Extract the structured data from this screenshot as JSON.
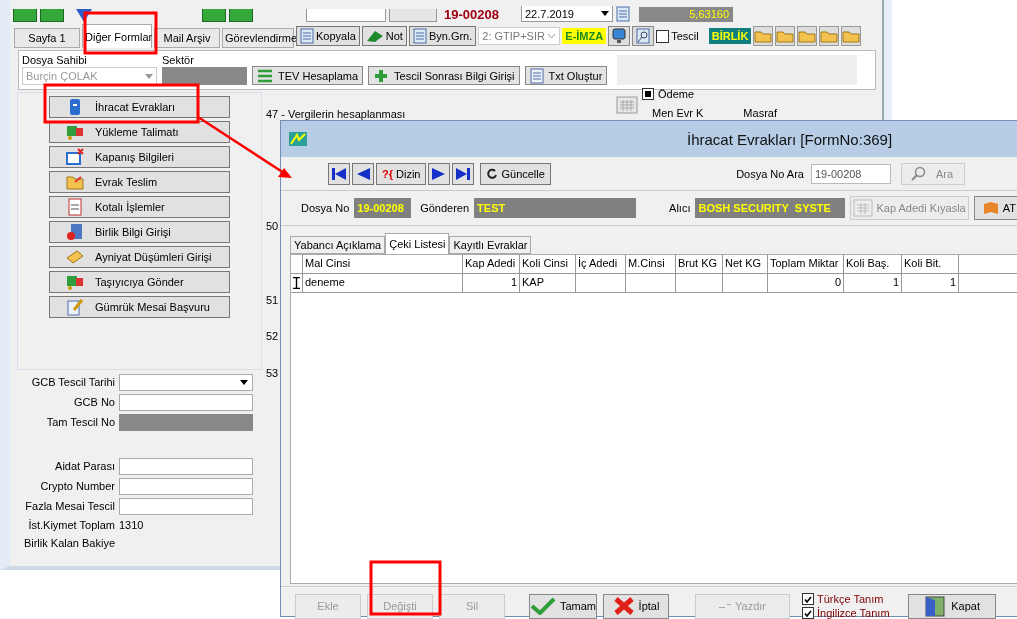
{
  "main_window": {
    "top_bar": {
      "file_no": "19-00208",
      "date": "22.7.2019",
      "rate": "5,63160"
    },
    "tabs": [
      {
        "label": "Sayfa 1",
        "selected": false
      },
      {
        "label": "Diğer Formlar",
        "selected": true
      },
      {
        "label": "Mail Arşiv",
        "selected": false
      },
      {
        "label": "Görevlendirme",
        "selected": false
      }
    ],
    "toolbar": {
      "buttons": [
        "Kopyala",
        "Not",
        "Byn.Grn."
      ],
      "mode_dropdown": "2: GTIP+SIR",
      "eimza": "E-İMZA",
      "tescil": {
        "label": "Tescil",
        "checked": false
      },
      "birlik": "BİRLİK"
    },
    "header": {
      "owner_label": "Dosya Sahibi",
      "owner_value": "Burçin ÇOLAK",
      "sector_label": "Sektör",
      "buttons": [
        "TEV Hesaplama",
        "Tescil Sonrası Bilgi Girişi",
        "Txt Oluştur"
      ]
    },
    "form_buttons": [
      "İhracat Evrakları",
      "Yükleme Talimatı",
      "Kapanış Bilgileri",
      "Evrak Teslim",
      "Kotalı İşlemler",
      "Birlik Bilgi Girişi",
      "Ayniyat Düşümleri Girişi",
      "Taşıyıcıya Gönder",
      "Gümrük Mesai Başvuru"
    ],
    "fields_top": [
      {
        "label": "GCB Tescil Tarihi",
        "kind": "dropdown"
      },
      {
        "label": "GCB No",
        "kind": "input"
      },
      {
        "label": "Tam Tescil No",
        "kind": "readonly"
      }
    ],
    "fields_bottom": [
      {
        "label": "Aidat Parası",
        "kind": "input"
      },
      {
        "label": "Crypto Number",
        "kind": "input"
      },
      {
        "label": "Fazla Mesai Tescil",
        "kind": "input"
      },
      {
        "label": "İst.Kiymet Toplam",
        "kind": "text",
        "value": "1310"
      },
      {
        "label": "Birlik Kalan Bakiye",
        "kind": "text"
      }
    ],
    "middle": {
      "section_title": "47 - Vergilerin hesaplanması",
      "row_numbers": [
        "50",
        "51",
        "52",
        "53"
      ],
      "odeme": {
        "label": "Ödeme",
        "checked": true
      },
      "links": [
        "Men Evr K",
        "Masraf"
      ]
    }
  },
  "dialog": {
    "title": "İhracat Evrakları [FormNo:369]",
    "index_button": {
      "mark": "?{",
      "label": "Dizin"
    },
    "refresh_button": "Güncelle",
    "search": {
      "label": "Dosya No Ara",
      "value": "19-00208",
      "button": "Ara"
    },
    "info": {
      "file_label": "Dosya No",
      "file_no": "19-00208",
      "sender_label": "Gönderen",
      "sender": "TEST",
      "receiver_label": "Alıcı",
      "receiver": "BOSH SECURITY  SYSTE",
      "compare_button": "Kap Adedi Kıyasla",
      "atr_button": "AT"
    },
    "tabs": [
      {
        "label": "Yabancı Açıklama",
        "selected": false
      },
      {
        "label": "Çeki Listesi",
        "selected": true
      },
      {
        "label": "Kayıtlı Evraklar",
        "selected": false
      }
    ],
    "table": {
      "columns": [
        "Mal Cinsi",
        "Kap Adedi",
        "Koli Cinsi",
        "İç Adedi",
        "M.Cinsi",
        "Brut KG",
        "Net KG",
        "Toplam Miktar",
        "Koli Baş.",
        "Koli Bit."
      ],
      "rows": [
        {
          "selected": true,
          "cells": [
            "deneme",
            "1",
            "KAP",
            null,
            null,
            null,
            null,
            "0",
            "1",
            "1"
          ]
        }
      ]
    },
    "buttons": [
      {
        "label": "Ekle",
        "kind": "plain",
        "disabled": true
      },
      {
        "label": "Değişti",
        "kind": "plain",
        "disabled": true
      },
      {
        "label": "Sil",
        "kind": "plain",
        "disabled": true
      },
      {
        "label": "Tamam",
        "kind": "ok",
        "disabled": false
      },
      {
        "label": "İptal",
        "kind": "cancel",
        "disabled": false
      },
      {
        "label": "Yazdır",
        "kind": "print",
        "disabled": true
      }
    ],
    "checks": [
      {
        "label": "Türkçe Tanım",
        "checked": true
      },
      {
        "label": "İngilizce Tanım",
        "checked": true
      }
    ],
    "close_button": "Kapat"
  }
}
